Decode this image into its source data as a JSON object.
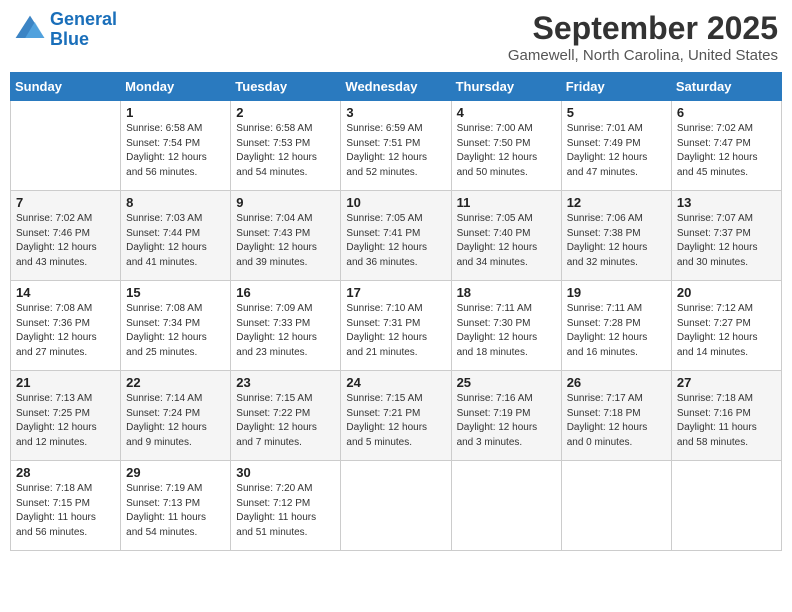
{
  "header": {
    "logo_line1": "General",
    "logo_line2": "Blue",
    "month": "September 2025",
    "location": "Gamewell, North Carolina, United States"
  },
  "days_of_week": [
    "Sunday",
    "Monday",
    "Tuesday",
    "Wednesday",
    "Thursday",
    "Friday",
    "Saturday"
  ],
  "weeks": [
    [
      {
        "day": "",
        "info": ""
      },
      {
        "day": "1",
        "info": "Sunrise: 6:58 AM\nSunset: 7:54 PM\nDaylight: 12 hours\nand 56 minutes."
      },
      {
        "day": "2",
        "info": "Sunrise: 6:58 AM\nSunset: 7:53 PM\nDaylight: 12 hours\nand 54 minutes."
      },
      {
        "day": "3",
        "info": "Sunrise: 6:59 AM\nSunset: 7:51 PM\nDaylight: 12 hours\nand 52 minutes."
      },
      {
        "day": "4",
        "info": "Sunrise: 7:00 AM\nSunset: 7:50 PM\nDaylight: 12 hours\nand 50 minutes."
      },
      {
        "day": "5",
        "info": "Sunrise: 7:01 AM\nSunset: 7:49 PM\nDaylight: 12 hours\nand 47 minutes."
      },
      {
        "day": "6",
        "info": "Sunrise: 7:02 AM\nSunset: 7:47 PM\nDaylight: 12 hours\nand 45 minutes."
      }
    ],
    [
      {
        "day": "7",
        "info": "Sunrise: 7:02 AM\nSunset: 7:46 PM\nDaylight: 12 hours\nand 43 minutes."
      },
      {
        "day": "8",
        "info": "Sunrise: 7:03 AM\nSunset: 7:44 PM\nDaylight: 12 hours\nand 41 minutes."
      },
      {
        "day": "9",
        "info": "Sunrise: 7:04 AM\nSunset: 7:43 PM\nDaylight: 12 hours\nand 39 minutes."
      },
      {
        "day": "10",
        "info": "Sunrise: 7:05 AM\nSunset: 7:41 PM\nDaylight: 12 hours\nand 36 minutes."
      },
      {
        "day": "11",
        "info": "Sunrise: 7:05 AM\nSunset: 7:40 PM\nDaylight: 12 hours\nand 34 minutes."
      },
      {
        "day": "12",
        "info": "Sunrise: 7:06 AM\nSunset: 7:38 PM\nDaylight: 12 hours\nand 32 minutes."
      },
      {
        "day": "13",
        "info": "Sunrise: 7:07 AM\nSunset: 7:37 PM\nDaylight: 12 hours\nand 30 minutes."
      }
    ],
    [
      {
        "day": "14",
        "info": "Sunrise: 7:08 AM\nSunset: 7:36 PM\nDaylight: 12 hours\nand 27 minutes."
      },
      {
        "day": "15",
        "info": "Sunrise: 7:08 AM\nSunset: 7:34 PM\nDaylight: 12 hours\nand 25 minutes."
      },
      {
        "day": "16",
        "info": "Sunrise: 7:09 AM\nSunset: 7:33 PM\nDaylight: 12 hours\nand 23 minutes."
      },
      {
        "day": "17",
        "info": "Sunrise: 7:10 AM\nSunset: 7:31 PM\nDaylight: 12 hours\nand 21 minutes."
      },
      {
        "day": "18",
        "info": "Sunrise: 7:11 AM\nSunset: 7:30 PM\nDaylight: 12 hours\nand 18 minutes."
      },
      {
        "day": "19",
        "info": "Sunrise: 7:11 AM\nSunset: 7:28 PM\nDaylight: 12 hours\nand 16 minutes."
      },
      {
        "day": "20",
        "info": "Sunrise: 7:12 AM\nSunset: 7:27 PM\nDaylight: 12 hours\nand 14 minutes."
      }
    ],
    [
      {
        "day": "21",
        "info": "Sunrise: 7:13 AM\nSunset: 7:25 PM\nDaylight: 12 hours\nand 12 minutes."
      },
      {
        "day": "22",
        "info": "Sunrise: 7:14 AM\nSunset: 7:24 PM\nDaylight: 12 hours\nand 9 minutes."
      },
      {
        "day": "23",
        "info": "Sunrise: 7:15 AM\nSunset: 7:22 PM\nDaylight: 12 hours\nand 7 minutes."
      },
      {
        "day": "24",
        "info": "Sunrise: 7:15 AM\nSunset: 7:21 PM\nDaylight: 12 hours\nand 5 minutes."
      },
      {
        "day": "25",
        "info": "Sunrise: 7:16 AM\nSunset: 7:19 PM\nDaylight: 12 hours\nand 3 minutes."
      },
      {
        "day": "26",
        "info": "Sunrise: 7:17 AM\nSunset: 7:18 PM\nDaylight: 12 hours\nand 0 minutes."
      },
      {
        "day": "27",
        "info": "Sunrise: 7:18 AM\nSunset: 7:16 PM\nDaylight: 11 hours\nand 58 minutes."
      }
    ],
    [
      {
        "day": "28",
        "info": "Sunrise: 7:18 AM\nSunset: 7:15 PM\nDaylight: 11 hours\nand 56 minutes."
      },
      {
        "day": "29",
        "info": "Sunrise: 7:19 AM\nSunset: 7:13 PM\nDaylight: 11 hours\nand 54 minutes."
      },
      {
        "day": "30",
        "info": "Sunrise: 7:20 AM\nSunset: 7:12 PM\nDaylight: 11 hours\nand 51 minutes."
      },
      {
        "day": "",
        "info": ""
      },
      {
        "day": "",
        "info": ""
      },
      {
        "day": "",
        "info": ""
      },
      {
        "day": "",
        "info": ""
      }
    ]
  ]
}
